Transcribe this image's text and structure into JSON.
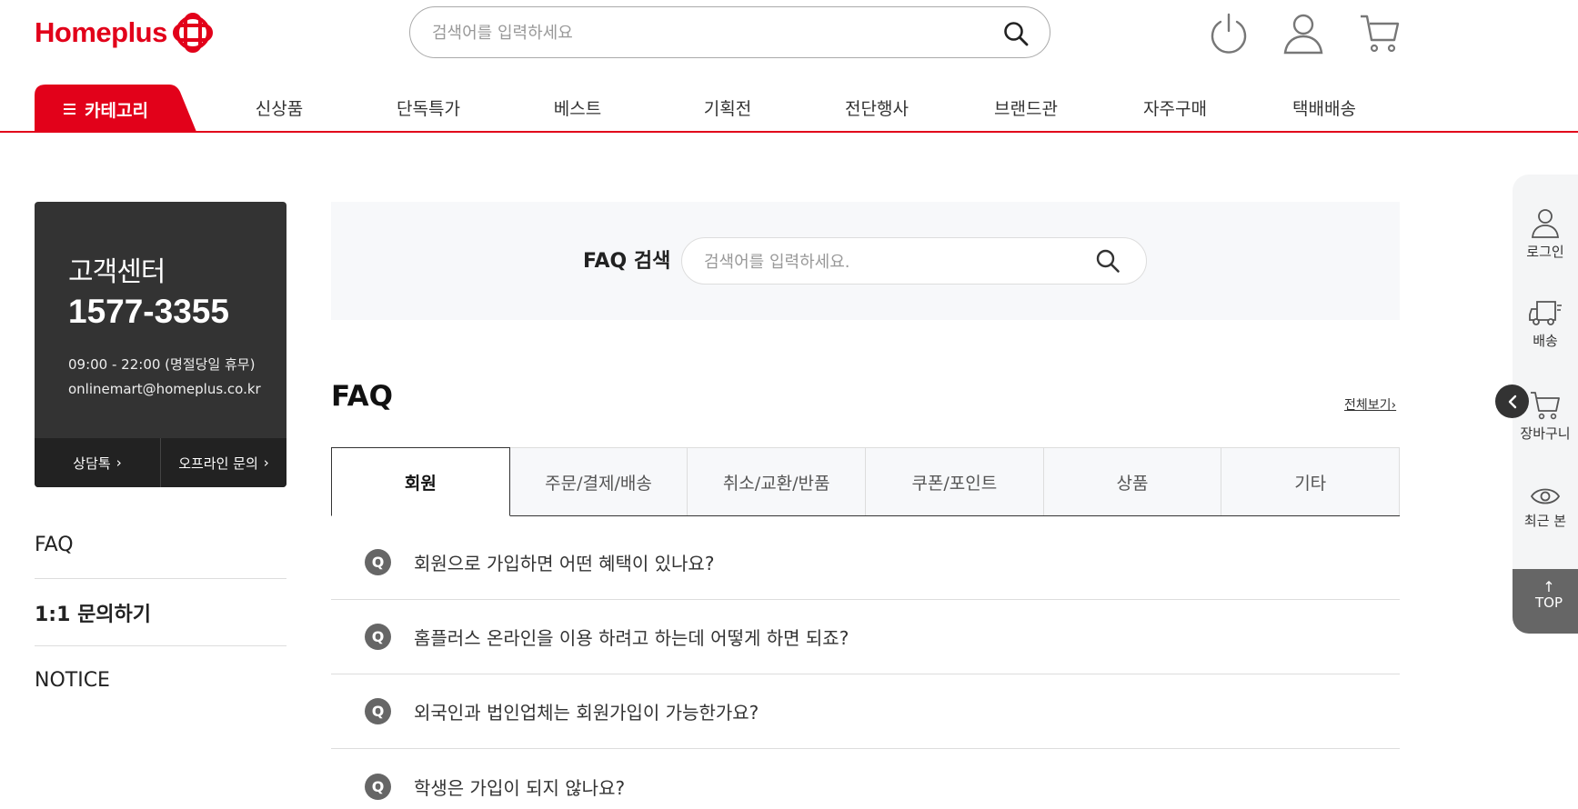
{
  "header": {
    "logo_text": "Homeplus",
    "search_placeholder": "검색어를 입력하세요",
    "icons": [
      "power-icon",
      "user-icon",
      "cart-icon"
    ]
  },
  "nav": {
    "category_label": "카테고리",
    "items": [
      "신상품",
      "단독특가",
      "베스트",
      "기획전",
      "전단행사",
      "브랜드관",
      "자주구매",
      "택배배송"
    ]
  },
  "customer_center": {
    "title": "고객센터",
    "phone": "1577-3355",
    "hours": "09:00 - 22:00 (명절당일 휴무)",
    "email": "onlinemart@homeplus.co.kr",
    "links": [
      "상담톡",
      "오프라인 문의"
    ]
  },
  "side_menu": [
    "FAQ",
    "1:1 문의하기",
    "NOTICE"
  ],
  "faq_search": {
    "label": "FAQ 검색",
    "placeholder": "검색어를 입력하세요."
  },
  "faq": {
    "heading": "FAQ",
    "view_all": "전체보기",
    "tabs": [
      "회원",
      "주문/결제/배송",
      "취소/교환/반품",
      "쿠폰/포인트",
      "상품",
      "기타"
    ],
    "active_tab": "회원",
    "q_mark": "Q",
    "questions": [
      "회원으로 가입하면 어떤 혜택이 있나요?",
      "홈플러스 온라인을 이용 하려고 하는데 어떻게 하면 되죠?",
      "외국인과 법인업체는 회원가입이 가능한가요?",
      "학생은 가입이 되지 않나요?"
    ]
  },
  "quick_panel": {
    "items": [
      "로그인",
      "배송",
      "장바구니",
      "최근 본"
    ],
    "top_label": "TOP"
  },
  "colors": {
    "brand_red": "#e2011a",
    "dark_box": "#333333",
    "panel_bg": "#f7f8fa"
  }
}
